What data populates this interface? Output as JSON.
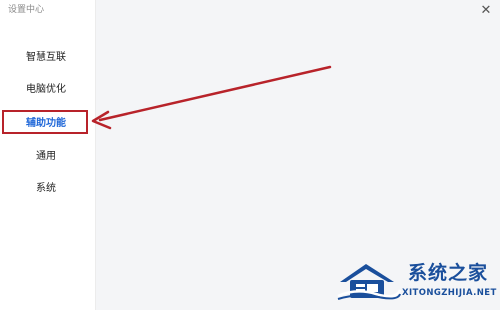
{
  "window": {
    "title": "设置中心",
    "close_glyph": "✕"
  },
  "sidebar": {
    "items": [
      {
        "label": "智慧互联",
        "active": false
      },
      {
        "label": "电脑优化",
        "active": false
      },
      {
        "label": "辅助功能",
        "active": true
      },
      {
        "label": "通用",
        "active": false
      },
      {
        "label": "系统",
        "active": false
      }
    ]
  },
  "annotation": {
    "color": "#b8232a",
    "target": "辅助功能"
  },
  "watermark": {
    "name": "系统之家",
    "domain": "XITONGZHIJIA.NET",
    "color": "#1a4f9c",
    "icon": "house-logo-icon"
  },
  "colors": {
    "accent": "#1f67d8",
    "background": "#f4f5f7"
  }
}
